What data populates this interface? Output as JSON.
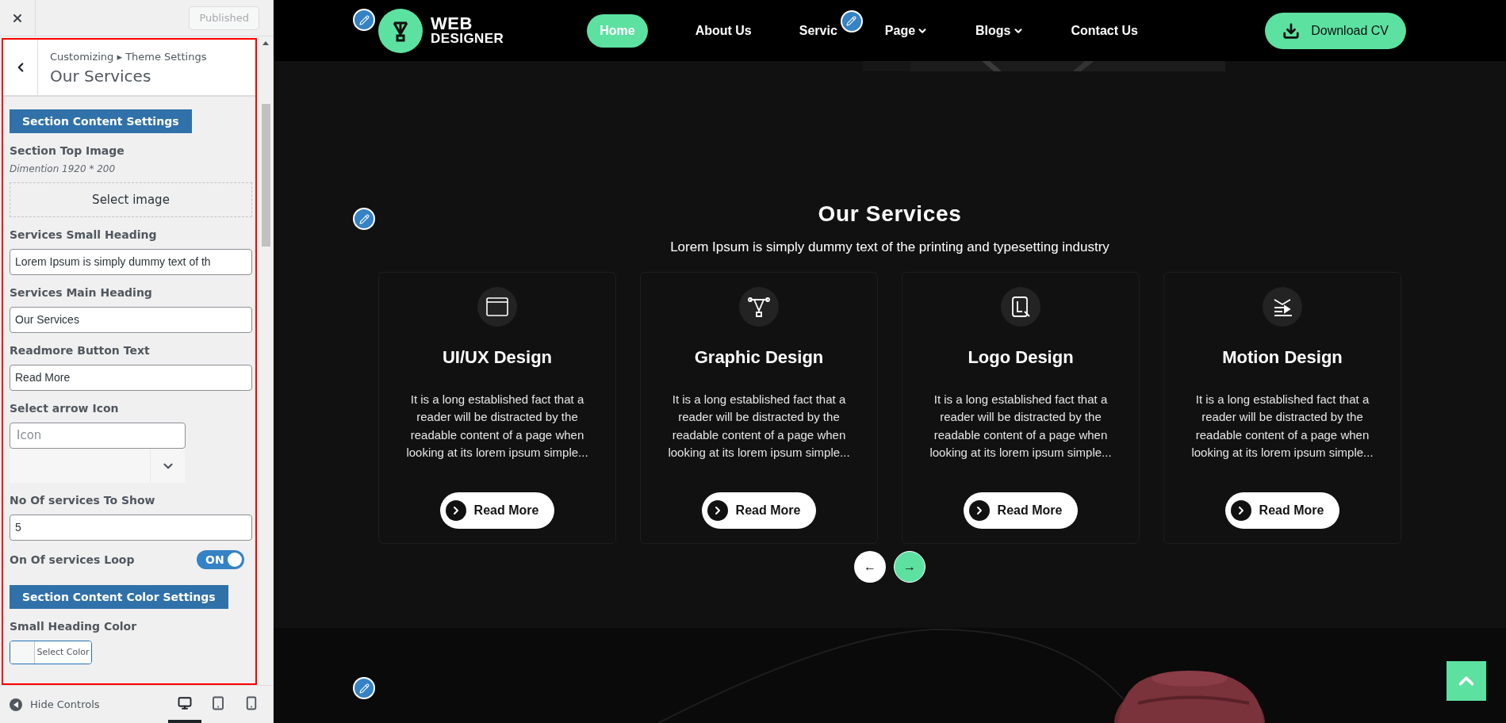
{
  "customizer": {
    "publish_button": {
      "label": "Published",
      "disabled": true
    },
    "breadcrumb": "Customizing ▸ Theme Settings",
    "panel_title": "Our Services",
    "controls": [
      {
        "kind": "section",
        "label": "Section Content Settings"
      },
      {
        "label": "Section Top Image",
        "description": "Dimention 1920 * 200",
        "button": "Select image"
      },
      {
        "kind": "text",
        "label": "Services Small Heading",
        "value": "Lorem Ipsum is simply dummy text of th"
      },
      {
        "kind": "text",
        "label": "Services Main Heading",
        "value": "Our Services"
      },
      {
        "kind": "text",
        "label": "Readmore Button Text",
        "value": "Read More"
      },
      {
        "kind": "icon_select",
        "label": "Select arrow Icon",
        "placeholder": "Icon"
      },
      {
        "kind": "text",
        "label": "No Of services To Show",
        "value": "5"
      },
      {
        "kind": "toggle",
        "label": "On Of services Loop",
        "on": true,
        "state_text": "ON"
      },
      {
        "kind": "section",
        "label": "Section Content Color Settings"
      },
      {
        "kind": "color",
        "label": "Small Heading Color",
        "button": "Select Color"
      }
    ],
    "footer": {
      "hide_controls": "Hide Controls",
      "devices": [
        {
          "kind": "desktop",
          "selected": true
        },
        {
          "kind": "tablet",
          "selected": false
        },
        {
          "kind": "mobile",
          "selected": false
        }
      ]
    }
  },
  "site": {
    "logo": {
      "line_1": "WEB",
      "line_2": "DESIGNER"
    },
    "nav": [
      {
        "label": "Home",
        "selected": true,
        "dropdown": false
      },
      {
        "label": "About Us",
        "selected": false,
        "dropdown": false
      },
      {
        "label": "Servic",
        "selected": false,
        "dropdown": false
      },
      {
        "label": "Page",
        "selected": false,
        "dropdown": true
      },
      {
        "label": "Blogs",
        "selected": false,
        "dropdown": true
      },
      {
        "label": "Contact Us",
        "selected": false,
        "dropdown": false
      }
    ],
    "cta": "Download CV",
    "services": {
      "title": "Our Services",
      "subtitle": "Lorem Ipsum is simply dummy text of the printing and typesetting industry",
      "cards": [
        {
          "kind": "ux",
          "title": "UI/UX Design",
          "text": "It is a long established fact that a reader will be distracted by the readable content of a page when looking at its lorem ipsum simple...",
          "button": "Read More"
        },
        {
          "kind": "pen",
          "title": "Graphic Design",
          "text": "It is a long established fact that a reader will be distracted by the readable content of a page when looking at its lorem ipsum simple...",
          "button": "Read More"
        },
        {
          "kind": "logo",
          "title": "Logo Design",
          "text": "It is a long established fact that a reader will be distracted by the readable content of a page when looking at its lorem ipsum simple...",
          "button": "Read More"
        },
        {
          "kind": "motion",
          "title": "Motion Design",
          "text": "It is a long established fact that a reader will be distracted by the readable content of a page when looking at its lorem ipsum simple...",
          "button": "Read More"
        }
      ],
      "carousel": [
        {
          "label": "←",
          "selected": false
        },
        {
          "label": "→",
          "selected": true
        }
      ]
    }
  }
}
